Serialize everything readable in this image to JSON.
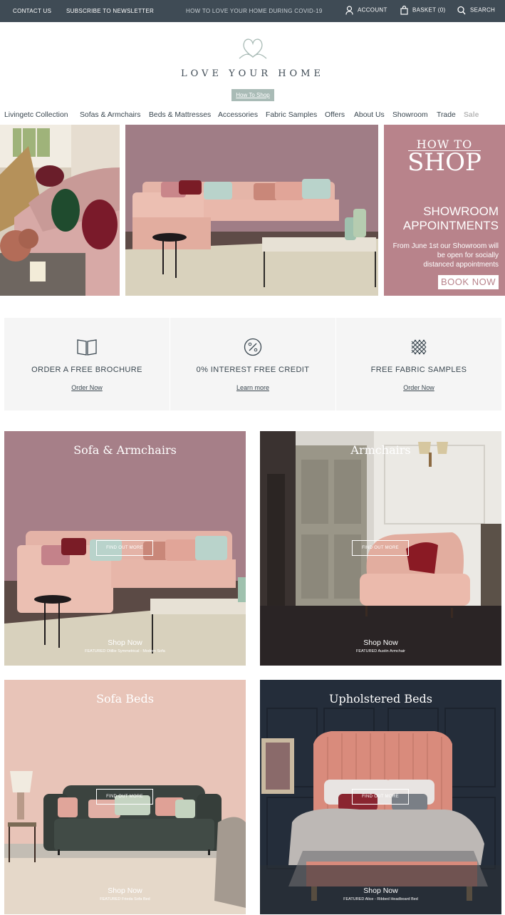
{
  "topbar": {
    "contact": "CONTACT US",
    "subscribe": "SUBSCRIBE TO NEWSLETTER",
    "covid": "HOW TO LOVE YOUR HOME DURING COVID-19",
    "account": "ACCOUNT",
    "basket": "BASKET (0)",
    "search": "SEARCH"
  },
  "brand": {
    "name": "LOVE YOUR HOME"
  },
  "howto_button": "How To Shop",
  "nav": [
    "Livingetc Collection",
    "Sofas & Armchairs",
    "Beds & Mattresses",
    "Accessories",
    "Fabric Samples",
    "Offers",
    "About Us",
    "Showroom",
    "Trade",
    "Sale"
  ],
  "promo": {
    "line1": "HOW TO",
    "line2": "SHOP",
    "showroom1": "SHOWROOM",
    "showroom2": "APPOINTMENTS",
    "body1": "From June 1st our Showroom will",
    "body2": "be open for socially",
    "body3": "distanced appointments",
    "cta": "BOOK NOW"
  },
  "features": [
    {
      "icon": "brochure-icon",
      "title": "ORDER A FREE BROCHURE",
      "link": "Order Now"
    },
    {
      "icon": "percent-icon",
      "title": "0% INTEREST FREE CREDIT",
      "link": "Learn more"
    },
    {
      "icon": "fabric-icon",
      "title": "FREE FABRIC SAMPLES",
      "link": "Order Now"
    }
  ],
  "cards": [
    {
      "title": "Sofa & Armchairs",
      "find": "FIND OUT MORE",
      "shop": "Shop Now",
      "featured": "FEATURED Otillie Symmetrical - Modern Sofa"
    },
    {
      "title": "Armchairs",
      "find": "FIND OUT MORE",
      "shop": "Shop Now",
      "featured": "FEATURED Austin Armchair"
    },
    {
      "title": "Sofa Beds",
      "find": "FIND OUT MORE",
      "shop": "Shop Now",
      "featured": "FEATURED Frieda Sofa Bed"
    },
    {
      "title": "Upholstered Beds",
      "find": "FIND OUT MORE",
      "shop": "Shop Now",
      "featured": "FEATURED Alice - Ribbed Headboard Bed"
    }
  ],
  "colors": {
    "topbar": "#3f4b55",
    "accent": "#a9bbb6",
    "promo": "#b8838b"
  }
}
